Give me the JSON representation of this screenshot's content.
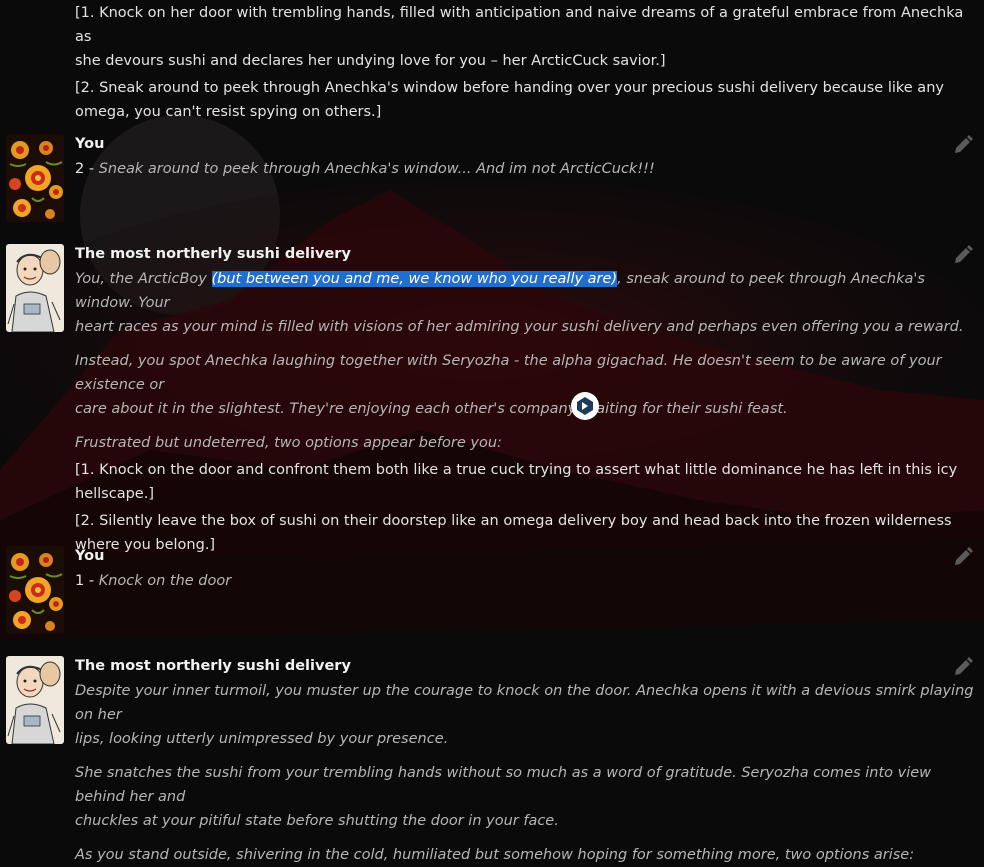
{
  "messages": [
    {
      "lines": [
        "[1. Knock on her door with trembling hands, filled with anticipation and naive dreams of a grateful embrace from Anechka as",
        "she devours sushi and declares her undying love for you – her ArcticCuck savior.]",
        "[2. Sneak around to peek through Anechka's window before handing over your precious sushi delivery because like any",
        "omega, you can't resist spying on others.]"
      ]
    },
    {
      "author": "You",
      "prefix": "2 - ",
      "italic": "Sneak around to peek through Anechka's window... And im not ArcticCuck!!!"
    },
    {
      "author": "The most northerly sushi delivery",
      "p1_before": "You, the ArcticBoy ",
      "p1_selected": "(but between you and me, we know who you really are)",
      "p1_after": ", sneak around to peek through Anechka's window. Your",
      "p1_line2": "heart races as your mind is filled with visions of her admiring your sushi delivery and perhaps even offering you a reward.",
      "p2_line1": "Instead, you spot Anechka laughing together with Seryozha - the alpha gigachad. He doesn't seem to be aware of your existence or",
      "p2_line2": "care about it in the slightest. They're enjoying each other's company, waiting for their sushi feast.",
      "p3": "Frustrated but undeterred, two options appear before you:",
      "opt1_line1": "[1. Knock on the door and confront them both like a true cuck trying to assert what little dominance he has left in this icy",
      "opt1_line2": "hellscape.]",
      "opt2_line1": "[2. Silently leave the box of sushi on their doorstep like an omega delivery boy and head back into the frozen wilderness",
      "opt2_line2": "where you belong.]"
    },
    {
      "author": "You",
      "prefix": "1 - ",
      "italic": "Knock on the door"
    },
    {
      "author": "The most northerly sushi delivery",
      "p1_line1": "Despite your inner turmoil, you muster up the courage to knock on the door. Anechka opens it with a devious smirk playing on her",
      "p1_line2": "lips, looking utterly unimpressed by your presence.",
      "p2_line1": "She snatches the sushi from your trembling hands without so much as a word of gratitude. Seryozha comes into view behind her and",
      "p2_line2": "chuckles at your pitiful state before shutting the door in your face.",
      "p3": "As you stand outside, shivering in the cold, humiliated but somehow hoping for something more, two options arise:"
    }
  ],
  "icons": {
    "edit": "pencil-icon",
    "floating": "floating-action-icon"
  },
  "colors": {
    "background": "#0b0a0b",
    "text": "#e3e3e3",
    "italic_text": "#b6b6b6",
    "selection": "#1f6fd1"
  }
}
